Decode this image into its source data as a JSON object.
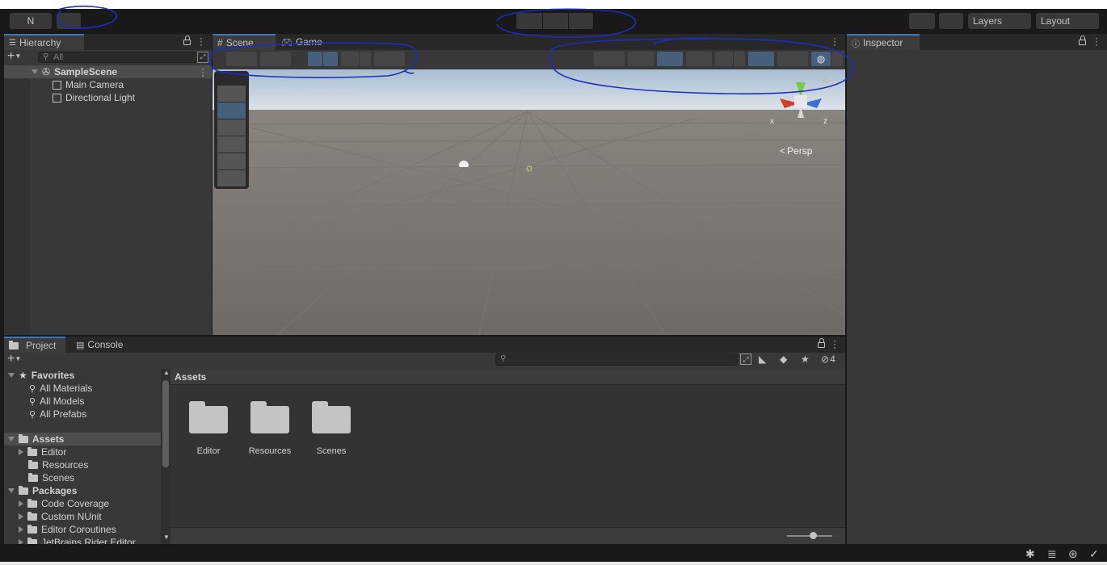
{
  "toolbar": {
    "account_label": "N",
    "layers_label": "Layers",
    "layout_label": "Layout"
  },
  "hierarchy": {
    "tab_label": "Hierarchy",
    "search_placeholder": "All",
    "scene_name": "SampleScene",
    "items": [
      "Main Camera",
      "Directional Light"
    ]
  },
  "scene_view": {
    "tabs": [
      "Scene",
      "Game"
    ],
    "persp_label": "Persp",
    "gizmo_axes": {
      "x": "x",
      "z": "z"
    }
  },
  "inspector": {
    "tab_label": "Inspector"
  },
  "project": {
    "tabs": [
      "Project",
      "Console"
    ],
    "hidden_count": "4",
    "breadcrumb": "Assets",
    "tree": {
      "favorites_label": "Favorites",
      "favorites": [
        "All Materials",
        "All Models",
        "All Prefabs"
      ],
      "assets_label": "Assets",
      "assets": [
        "Editor",
        "Resources",
        "Scenes"
      ],
      "packages_label": "Packages",
      "packages": [
        "Code Coverage",
        "Custom NUnit",
        "Editor Coroutines",
        "JetBrains Rider Editor"
      ]
    },
    "grid_items": [
      "Editor",
      "Resources",
      "Scenes"
    ]
  },
  "colors": {
    "accent": "#3a79bb",
    "toggled": "#46607c",
    "annotation_ink": "#1a2fbf"
  }
}
